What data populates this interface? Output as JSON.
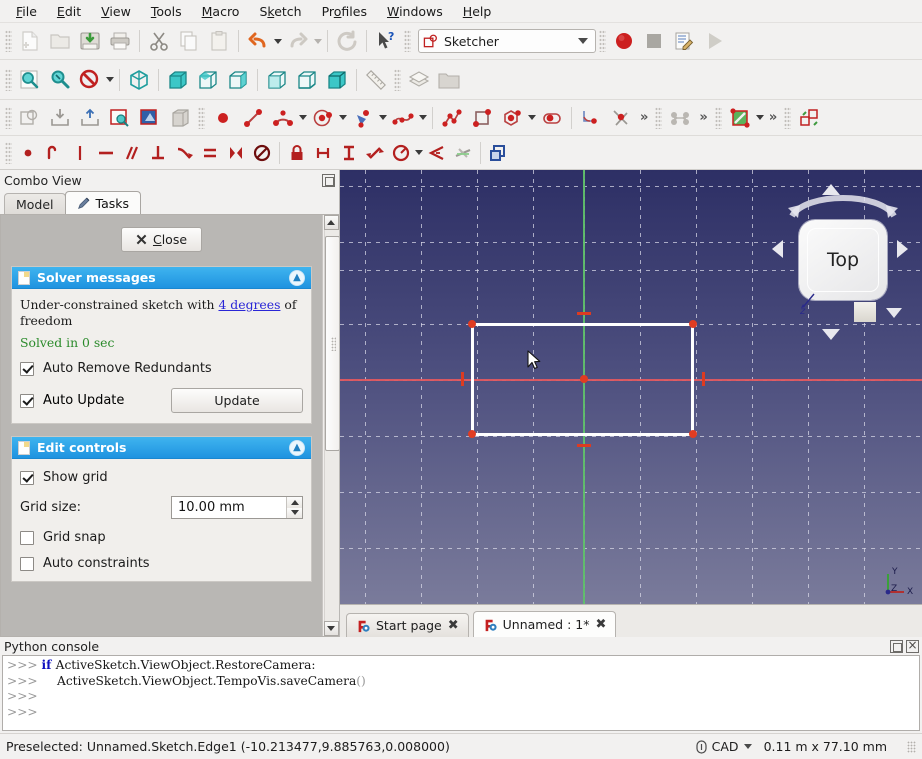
{
  "menu": {
    "items": [
      {
        "label": "File",
        "accel": "F"
      },
      {
        "label": "Edit",
        "accel": "E"
      },
      {
        "label": "View",
        "accel": "V"
      },
      {
        "label": "Tools",
        "accel": "T"
      },
      {
        "label": "Macro",
        "accel": "M"
      },
      {
        "label": "Sketch",
        "accel": "k"
      },
      {
        "label": "Profiles",
        "accel": "o"
      },
      {
        "label": "Windows",
        "accel": "W"
      },
      {
        "label": "Help",
        "accel": "H"
      }
    ]
  },
  "toolbars": {
    "file": [
      {
        "name": "new-document-icon",
        "label": "New"
      },
      {
        "name": "open-document-icon",
        "label": "Open"
      },
      {
        "name": "save-document-icon",
        "label": "Save"
      },
      {
        "name": "print-document-icon",
        "label": "Print"
      },
      {
        "name": "cut-icon",
        "label": "Cut"
      },
      {
        "name": "copy-icon",
        "label": "Copy"
      },
      {
        "name": "paste-icon",
        "label": "Paste"
      },
      {
        "name": "undo-icon",
        "label": "Undo"
      },
      {
        "name": "redo-icon",
        "label": "Redo"
      },
      {
        "name": "refresh-icon",
        "label": "Refresh"
      },
      {
        "name": "whats-this-icon",
        "label": "What's this?"
      }
    ],
    "workbench": {
      "selected": "Sketcher",
      "icon": "sketcher-workbench-icon"
    },
    "macro": [
      {
        "name": "macro-record-icon",
        "label": "Macro recording"
      },
      {
        "name": "macro-stop-icon",
        "label": "Stop macro recording"
      },
      {
        "name": "macro-edit-icon",
        "label": "Macros"
      },
      {
        "name": "macro-execute-icon",
        "label": "Execute macro"
      }
    ],
    "view": [
      {
        "name": "fit-all-icon",
        "label": "Fit all"
      },
      {
        "name": "fit-selection-icon",
        "label": "Fit selection"
      },
      {
        "name": "draw-style-icon",
        "label": "Draw style"
      },
      {
        "name": "isometric-view-icon",
        "label": "Isometric"
      },
      {
        "name": "front-view-icon",
        "label": "Front"
      },
      {
        "name": "top-view-icon",
        "label": "Top"
      },
      {
        "name": "right-view-icon",
        "label": "Right"
      },
      {
        "name": "rear-view-icon",
        "label": "Rear"
      },
      {
        "name": "bottom-view-icon",
        "label": "Bottom"
      },
      {
        "name": "left-view-icon",
        "label": "Left"
      },
      {
        "name": "measure-icon",
        "label": "Measure"
      },
      {
        "name": "workbench-layers-icon",
        "label": "Layers"
      },
      {
        "name": "folder-icon",
        "label": "Group"
      }
    ],
    "sketcher_edit": [
      {
        "name": "create-sketch-icon",
        "label": "Create sketch"
      },
      {
        "name": "attach-sketch-icon",
        "label": "Attach sketch"
      },
      {
        "name": "detach-sketch-icon",
        "label": "Detach sketch"
      },
      {
        "name": "edit-sketch-icon",
        "label": "Edit sketch"
      },
      {
        "name": "view-sketch-icon",
        "label": "View sketch"
      },
      {
        "name": "view-section-icon",
        "label": "View section"
      }
    ],
    "sketcher_geometry": [
      {
        "name": "point-icon",
        "label": "Create point"
      },
      {
        "name": "line-icon",
        "label": "Create line"
      },
      {
        "name": "arc-icon",
        "label": "Create arc"
      },
      {
        "name": "circle-icon",
        "label": "Create circle"
      },
      {
        "name": "conic-icon",
        "label": "Create conic"
      },
      {
        "name": "bspline-icon",
        "label": "Create B-spline"
      },
      {
        "name": "polyline-icon",
        "label": "Create polyline"
      },
      {
        "name": "rectangle-icon",
        "label": "Create rectangle"
      },
      {
        "name": "polygon-icon",
        "label": "Create regular polygon"
      },
      {
        "name": "slot-icon",
        "label": "Create slot"
      },
      {
        "name": "fillet-icon",
        "label": "Create fillet"
      },
      {
        "name": "trim-icon",
        "label": "Trim edge"
      },
      {
        "name": "geometry-more-icon",
        "label": "More"
      },
      {
        "name": "clone-icon",
        "label": "Clone"
      },
      {
        "name": "clone-more-icon",
        "label": "More"
      },
      {
        "name": "rectangular-array-icon",
        "label": "Rectangular array"
      },
      {
        "name": "virtual-space-icon",
        "label": "Toggle virtual space"
      }
    ],
    "sketcher_constraints": [
      {
        "name": "constrain-coincident-icon",
        "label": "Constrain coincident"
      },
      {
        "name": "constrain-point-on-object-icon",
        "label": "Constrain point onto object"
      },
      {
        "name": "constrain-vertical-icon",
        "label": "Constrain vertical"
      },
      {
        "name": "constrain-horizontal-icon",
        "label": "Constrain horizontal"
      },
      {
        "name": "constrain-parallel-icon",
        "label": "Constrain parallel"
      },
      {
        "name": "constrain-perpendicular-icon",
        "label": "Constrain perpendicular"
      },
      {
        "name": "constrain-tangent-icon",
        "label": "Constrain tangent"
      },
      {
        "name": "constrain-equal-icon",
        "label": "Constrain equal"
      },
      {
        "name": "constrain-symmetric-icon",
        "label": "Constrain symmetric"
      },
      {
        "name": "constrain-block-icon",
        "label": "Constrain block"
      },
      {
        "name": "constrain-lock-icon",
        "label": "Constrain lock"
      },
      {
        "name": "constrain-distance-horizontal-icon",
        "label": "Horizontal distance"
      },
      {
        "name": "constrain-distance-vertical-icon",
        "label": "Vertical distance"
      },
      {
        "name": "constrain-distance-icon",
        "label": "Constrain distance"
      },
      {
        "name": "constrain-radius-icon",
        "label": "Constrain radius"
      },
      {
        "name": "constrain-angle-icon",
        "label": "Constrain angle"
      },
      {
        "name": "constrain-refraction-icon",
        "label": "Constrain refraction"
      },
      {
        "name": "toggle-construction-icon",
        "label": "Toggle construction geometry"
      }
    ]
  },
  "combo_view": {
    "title": "Combo View",
    "float_button": "undock-icon",
    "tabs": [
      {
        "label": "Model",
        "active": false,
        "icon": "model-tree-icon"
      },
      {
        "label": "Tasks",
        "active": true,
        "icon": "pencil-icon"
      }
    ],
    "close_button": {
      "label": "Close",
      "accel": "C",
      "icon": "close-x-icon"
    },
    "solver": {
      "title": "Solver messages",
      "message_prefix": "Under-constrained sketch with ",
      "message_link": "4 degrees",
      "message_suffix": " of freedom",
      "solved_text": "Solved in 0 sec",
      "auto_remove_redundants": {
        "label": "Auto Remove Redundants",
        "checked": true
      },
      "auto_update": {
        "label": "Auto Update",
        "checked": true
      },
      "update_button": "Update"
    },
    "edit_controls": {
      "title": "Edit controls",
      "show_grid": {
        "label": "Show grid",
        "checked": true
      },
      "grid_size": {
        "label": "Grid size:",
        "value": "10.00 mm"
      },
      "grid_snap": {
        "label": "Grid snap",
        "checked": false
      },
      "auto_constraints": {
        "label": "Auto constraints",
        "checked": false
      }
    }
  },
  "viewport": {
    "nav_cube_label": "Top",
    "axis_labels": {
      "y": "Y",
      "z": "Z",
      "x": "X"
    },
    "colors": {
      "background_top": "#2d2f65",
      "background_bottom": "#7a7b9b",
      "grid": "#d9d9e8",
      "x_axis": "#e0585f",
      "y_axis": "#5fbf6a",
      "edge": "#ffffff",
      "vertex": "#e03c22",
      "constraint": "#dd3b21"
    },
    "tabs": [
      {
        "label": "Start page",
        "active": false,
        "icon": "freecad-icon",
        "close": "×"
      },
      {
        "label": "Unnamed : 1*",
        "active": true,
        "icon": "freecad-icon",
        "close": "×"
      }
    ]
  },
  "python_console": {
    "title": "Python console",
    "float_button": "undock-icon",
    "close_button": "close-icon",
    "lines": [
      {
        "prompt": ">>> ",
        "indent": "",
        "keyword": "if ",
        "text": "ActiveSketch.ViewObject.RestoreCamera:",
        "paren": ""
      },
      {
        "prompt": ">>> ",
        "indent": "    ",
        "keyword": "",
        "text": "ActiveSketch.ViewObject.TempoVis.saveCamera",
        "paren": "()"
      },
      {
        "prompt": ">>> ",
        "indent": "",
        "keyword": "",
        "text": "",
        "paren": ""
      },
      {
        "prompt": ">>> ",
        "indent": "",
        "keyword": "",
        "text": "",
        "paren": ""
      }
    ]
  },
  "status_bar": {
    "message": "Preselected: Unnamed.Sketch.Edge1 (-10.213477,9.885763,0.008000)",
    "unit_icon": "dimension-icon",
    "unit_system": "CAD",
    "dimensions": "0.11 m x 77.10 mm"
  }
}
